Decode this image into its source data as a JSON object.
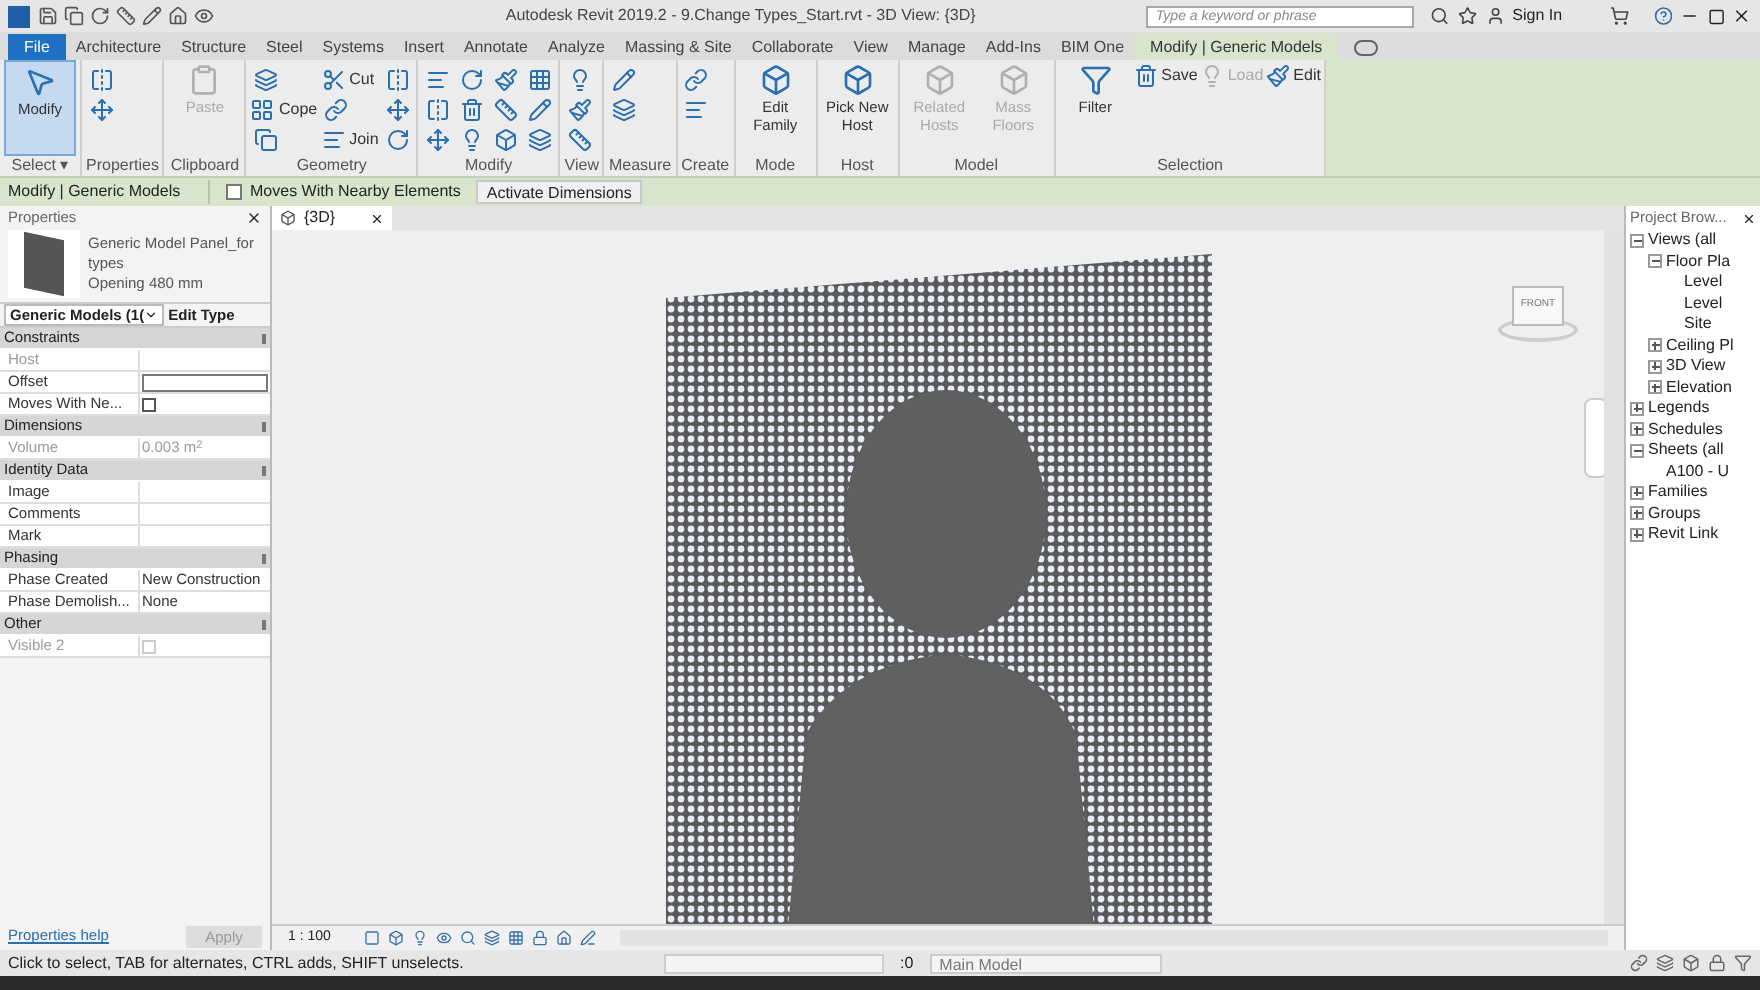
{
  "window": {
    "title": "Autodesk Revit 2019.2 - 9.Change Types_Start.rvt - 3D View: {3D}",
    "search": {
      "placeholder": "Type a keyword or phrase"
    },
    "sign_in": "Sign In"
  },
  "tabs": [
    {
      "label": "File",
      "kind": "file",
      "selected": false
    },
    {
      "label": "Architecture",
      "kind": "tab",
      "selected": false
    },
    {
      "label": "Structure",
      "kind": "tab",
      "selected": false
    },
    {
      "label": "Steel",
      "kind": "tab",
      "selected": false
    },
    {
      "label": "Systems",
      "kind": "tab",
      "selected": false
    },
    {
      "label": "Insert",
      "kind": "tab",
      "selected": false
    },
    {
      "label": "Annotate",
      "kind": "tab",
      "selected": false
    },
    {
      "label": "Analyze",
      "kind": "tab",
      "selected": false
    },
    {
      "label": "Massing & Site",
      "kind": "tab",
      "selected": false
    },
    {
      "label": "Collaborate",
      "kind": "tab",
      "selected": false
    },
    {
      "label": "View",
      "kind": "tab",
      "selected": false
    },
    {
      "label": "Manage",
      "kind": "tab",
      "selected": false
    },
    {
      "label": "Add-Ins",
      "kind": "tab",
      "selected": false
    },
    {
      "label": "BIM One",
      "kind": "tab",
      "selected": false
    },
    {
      "label": "Modify | Generic Models",
      "kind": "tab",
      "selected": true
    }
  ],
  "ribbon": [
    {
      "label": "Select ▾",
      "tools": [
        {
          "kind": "large",
          "label": "Modify",
          "selected": true,
          "disabled": false
        }
      ]
    },
    {
      "label": "Properties",
      "tools": [
        {
          "kind": "icon",
          "disabled": false
        },
        {
          "kind": "icon",
          "disabled": false
        }
      ]
    },
    {
      "label": "Clipboard",
      "tools": [
        {
          "kind": "large",
          "label": "Paste",
          "selected": false,
          "disabled": true
        }
      ]
    },
    {
      "label": "Geometry",
      "tools": [
        {
          "kind": "icon",
          "disabled": false
        },
        {
          "kind": "small",
          "label": "Cope",
          "disabled": false
        },
        {
          "kind": "icon",
          "disabled": false
        },
        {
          "kind": "small",
          "label": "Cut",
          "disabled": false
        },
        {
          "kind": "icon",
          "disabled": false
        },
        {
          "kind": "small",
          "label": "Join",
          "disabled": false
        },
        {
          "kind": "icon",
          "disabled": false
        },
        {
          "kind": "icon",
          "disabled": false
        },
        {
          "kind": "icon",
          "disabled": false
        }
      ]
    },
    {
      "label": "Modify",
      "tools": [
        {
          "kind": "icon",
          "disabled": false
        },
        {
          "kind": "icon",
          "disabled": false
        },
        {
          "kind": "icon",
          "disabled": false
        },
        {
          "kind": "icon",
          "disabled": false
        },
        {
          "kind": "icon",
          "disabled": false
        },
        {
          "kind": "icon",
          "disabled": false
        },
        {
          "kind": "icon",
          "disabled": false
        },
        {
          "kind": "icon",
          "disabled": false
        },
        {
          "kind": "icon",
          "disabled": false
        },
        {
          "kind": "icon",
          "disabled": false
        },
        {
          "kind": "icon",
          "disabled": false
        },
        {
          "kind": "icon",
          "disabled": false
        }
      ]
    },
    {
      "label": "View",
      "tools": [
        {
          "kind": "icon",
          "disabled": false
        },
        {
          "kind": "icon",
          "disabled": false
        },
        {
          "kind": "icon",
          "disabled": false
        }
      ]
    },
    {
      "label": "Measure",
      "tools": [
        {
          "kind": "icon",
          "disabled": false
        },
        {
          "kind": "icon",
          "disabled": false
        }
      ]
    },
    {
      "label": "Create",
      "tools": [
        {
          "kind": "icon",
          "disabled": false
        },
        {
          "kind": "icon",
          "disabled": false
        }
      ]
    },
    {
      "label": "Mode",
      "tools": [
        {
          "kind": "large",
          "label": "Edit Family",
          "selected": false,
          "disabled": false
        }
      ]
    },
    {
      "label": "Host",
      "tools": [
        {
          "kind": "large",
          "label": "Pick New Host",
          "selected": false,
          "disabled": false
        }
      ]
    },
    {
      "label": "Model",
      "tools": [
        {
          "kind": "large",
          "label": "Related Hosts",
          "selected": false,
          "disabled": true
        },
        {
          "kind": "large",
          "label": "Mass Floors",
          "selected": false,
          "disabled": true
        }
      ]
    },
    {
      "label": "Selection",
      "tools": [
        {
          "kind": "large",
          "label": "Filter",
          "selected": false,
          "disabled": false
        },
        {
          "kind": "small",
          "label": "Save",
          "disabled": false
        },
        {
          "kind": "small",
          "label": "Load",
          "disabled": true
        },
        {
          "kind": "small",
          "label": "Edit",
          "disabled": false
        }
      ]
    }
  ],
  "options_bar": {
    "context": "Modify | Generic Models",
    "moves_with_nearby": {
      "label": "Moves With Nearby Elements",
      "checked": false
    },
    "activate_dimensions": "Activate Dimensions"
  },
  "properties": {
    "title": "Properties",
    "type_name": "Generic Model Panel_for types",
    "type_detail": "Opening 480 mm",
    "category": "Generic Models (1(",
    "edit_type": "Edit Type",
    "rows": [
      {
        "kind": "section",
        "label": "Constraints"
      },
      {
        "kind": "text",
        "label": "Host",
        "disabled": true
      },
      {
        "kind": "input",
        "label": "Offset",
        "disabled": false
      },
      {
        "kind": "checkbox",
        "label": "Moves With Ne...",
        "checked": false,
        "disabled": false
      },
      {
        "kind": "section",
        "label": "Dimensions"
      },
      {
        "kind": "text",
        "label": "Volume",
        "value": "0.003 m$^{2}$",
        "disabled": true
      },
      {
        "kind": "section",
        "label": "Identity Data"
      },
      {
        "kind": "text",
        "label": "Image",
        "disabled": false
      },
      {
        "kind": "text",
        "label": "Comments",
        "disabled": false
      },
      {
        "kind": "text",
        "label": "Mark",
        "disabled": false
      },
      {
        "kind": "section",
        "label": "Phasing"
      },
      {
        "kind": "text",
        "label": "Phase Created",
        "value": "New Construction",
        "disabled": false
      },
      {
        "kind": "text",
        "label": "Phase Demolish...",
        "value": "None",
        "disabled": false
      },
      {
        "kind": "section",
        "label": "Other"
      },
      {
        "kind": "checkbox",
        "label": "Visible 2",
        "checked": false,
        "disabled": true
      }
    ],
    "help_link": "Properties help",
    "apply": "Apply"
  },
  "view": {
    "tab": "{3D}",
    "viewcube_face": "FRONT",
    "scale": "1 : 100"
  },
  "project_browser": {
    "title": "Project Brow...",
    "tree": [
      {
        "label": "Views (all",
        "expanded": true,
        "children": [
          {
            "label": "Floor Pla",
            "expanded": true,
            "children": [
              {
                "label": "Level"
              },
              {
                "label": "Level"
              },
              {
                "label": "Site"
              }
            ]
          },
          {
            "label": "Ceiling Pl",
            "expanded": false
          },
          {
            "label": "3D View",
            "expanded": false
          },
          {
            "label": "Elevation",
            "expanded": false
          }
        ]
      },
      {
        "label": "Legends",
        "expanded": false
      },
      {
        "label": "Schedules",
        "expanded": false
      },
      {
        "label": "Sheets (all",
        "expanded": true,
        "children": [
          {
            "label": "A100 - U"
          }
        ]
      },
      {
        "label": "Families",
        "expanded": false
      },
      {
        "label": "Groups",
        "expanded": false
      },
      {
        "label": "Revit Link",
        "expanded": false
      }
    ]
  },
  "status_bar": {
    "message": "Click to select, TAB for alternates, CTRL adds, SHIFT unselects.",
    "workset_count": ":0",
    "model": "Main Model"
  }
}
